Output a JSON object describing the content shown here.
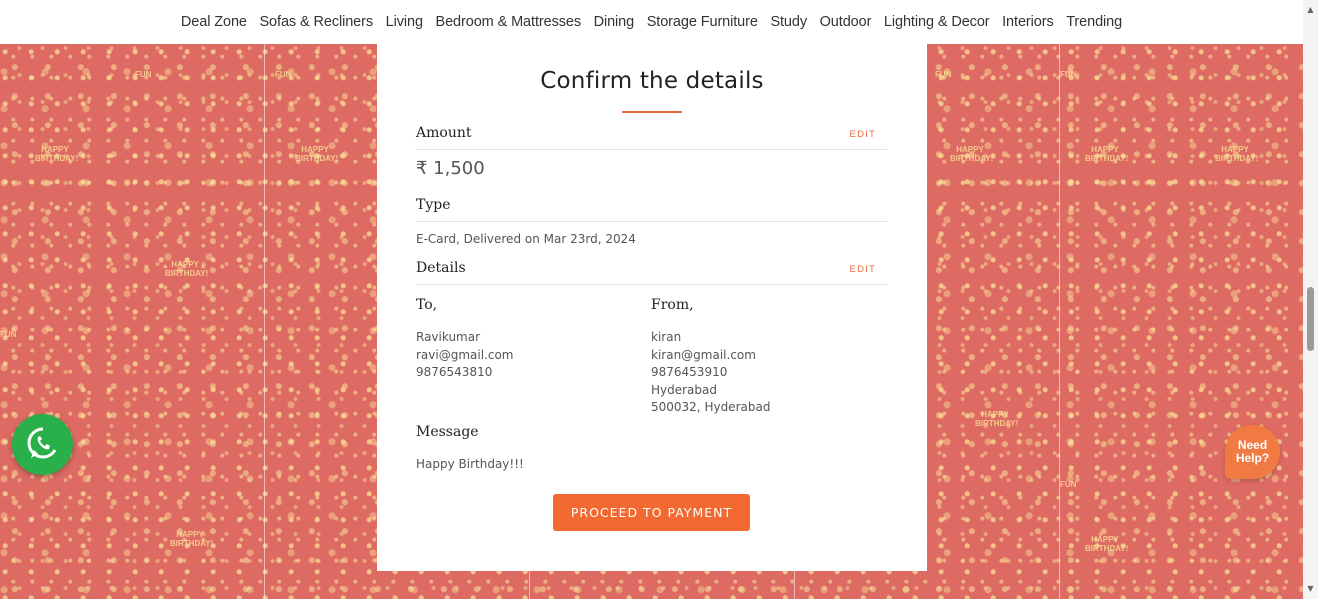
{
  "nav": {
    "items": [
      "Deal Zone",
      "Sofas & Recliners",
      "Living",
      "Bedroom & Mattresses",
      "Dining",
      "Storage Furniture",
      "Study",
      "Outdoor",
      "Lighting & Decor",
      "Interiors",
      "Trending"
    ]
  },
  "pattern": {
    "word_fun": "FUN",
    "word_birthday": "HAPPY BIRTHDAY!"
  },
  "card": {
    "title": "Confirm the details",
    "amount_label": "Amount",
    "amount_edit": "EDIT",
    "amount_value": "₹ 1,500",
    "type_label": "Type",
    "type_value": "E-Card, Delivered on Mar 23rd, 2024",
    "details_label": "Details",
    "details_edit": "EDIT",
    "to_label": "To,",
    "to": {
      "name": "Ravikumar",
      "email": "ravi@gmail.com",
      "phone": "9876543810"
    },
    "from_label": "From,",
    "from": {
      "name": "kiran",
      "email": "kiran@gmail.com",
      "phone": "9876453910",
      "city": "Hyderabad",
      "pin": "500032, Hyderabad"
    },
    "message_label": "Message",
    "message_value": "Happy Birthday!!!",
    "proceed_label": "PROCEED TO PAYMENT"
  },
  "help": {
    "line1": "Need",
    "line2": "Help?"
  },
  "colors": {
    "accent": "#f26a32",
    "background": "#de6a64",
    "whatsapp": "#29b04a"
  },
  "icons": {
    "whatsapp": "whatsapp-icon",
    "scroll_up": "chevron-up-icon",
    "scroll_down": "chevron-down-icon"
  }
}
